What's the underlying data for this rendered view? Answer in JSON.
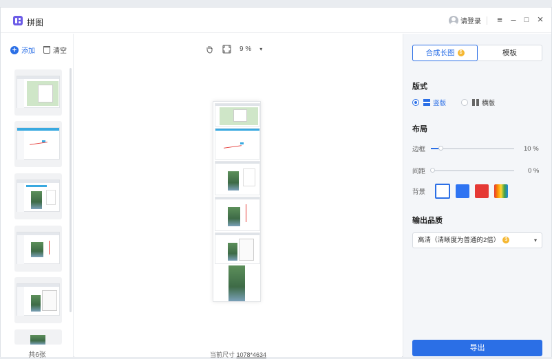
{
  "app": {
    "title": "拼图"
  },
  "titlebar": {
    "login_label": "请登录",
    "menu_icon": "≡",
    "minimize_icon": "–",
    "maximize_icon": "□",
    "close_icon": "×"
  },
  "left": {
    "add_label": "添加",
    "clear_label": "清空",
    "count_label": "共6张"
  },
  "toolbar": {
    "zoom_value": "9 %",
    "zoom_caret": "▾"
  },
  "canvas": {
    "size_label": "当前尺寸",
    "size_value": "1078*4634"
  },
  "right": {
    "tabs": [
      {
        "label": "合成长图",
        "active": true,
        "coin": "$"
      },
      {
        "label": "模板",
        "active": false
      }
    ],
    "layout_title": "版式",
    "layout_options": [
      {
        "label": "竖版",
        "selected": true
      },
      {
        "label": "横版",
        "selected": false
      }
    ],
    "arrange_title": "布局",
    "border": {
      "label": "边框",
      "value": 10,
      "display": "10 %"
    },
    "spacing": {
      "label": "间距",
      "value": 0,
      "display": "0 %"
    },
    "background_label": "背景",
    "background_colors": [
      "#ffffff",
      "#2f74f2",
      "#e53935",
      "rainbow"
    ],
    "quality_title": "输出品质",
    "quality_value": "高清（清晰度为普通的2倍）",
    "quality_coin": "$",
    "export_label": "导出"
  },
  "colors": {
    "accent": "#2b6fe6",
    "coin": "#f5b731"
  }
}
